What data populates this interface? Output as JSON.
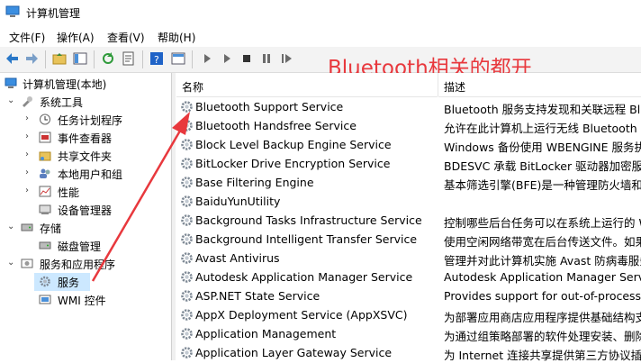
{
  "window": {
    "title": "计算机管理"
  },
  "menu": [
    "文件(F)",
    "操作(A)",
    "查看(V)",
    "帮助(H)"
  ],
  "annotation": "Bluetooth相关的都开",
  "tree": {
    "root": "计算机管理(本地)",
    "system_tools": "系统工具",
    "task_scheduler": "任务计划程序",
    "event_viewer": "事件查看器",
    "shared_folders": "共享文件夹",
    "local_users": "本地用户和组",
    "performance": "性能",
    "device_manager": "设备管理器",
    "storage": "存储",
    "disk_management": "磁盘管理",
    "services_apps": "服务和应用程序",
    "services": "服务",
    "wmi": "WMI 控件"
  },
  "list": {
    "col_name": "名称",
    "col_desc": "描述",
    "rows": [
      {
        "name": "Bluetooth Support Service",
        "desc": "Bluetooth 服务支持发现和关联远程 Blu"
      },
      {
        "name": "Bluetooth Handsfree Service",
        "desc": "允许在此计算机上运行无线 Bluetooth 耳"
      },
      {
        "name": "Block Level Backup Engine Service",
        "desc": "Windows 备份使用 WBENGINE 服务执行"
      },
      {
        "name": "BitLocker Drive Encryption Service",
        "desc": "BDESVC 承载 BitLocker 驱动器加密服务"
      },
      {
        "name": "Base Filtering Engine",
        "desc": "基本筛选引擎(BFE)是一种管理防火墙和 In"
      },
      {
        "name": "BaiduYunUtility",
        "desc": ""
      },
      {
        "name": "Background Tasks Infrastructure Service",
        "desc": "控制哪些后台任务可以在系统上运行的 Wi"
      },
      {
        "name": "Background Intelligent Transfer Service",
        "desc": "使用空闲网络带宽在后台传送文件。如果该"
      },
      {
        "name": "Avast Antivirus",
        "desc": "管理并对此计算机实施 Avast 防病毒服务"
      },
      {
        "name": "Autodesk Application Manager Service",
        "desc": "Autodesk Application Manager Service"
      },
      {
        "name": "ASP.NET State Service",
        "desc": "Provides support for out-of-process se"
      },
      {
        "name": "AppX Deployment Service (AppXSVC)",
        "desc": "为部署应用商店应用程序提供基础结构支持"
      },
      {
        "name": "Application Management",
        "desc": "为通过组策略部署的软件处理安装、删除以"
      },
      {
        "name": "Application Layer Gateway Service",
        "desc": "为 Internet 连接共享提供第三方协议插件"
      }
    ]
  }
}
